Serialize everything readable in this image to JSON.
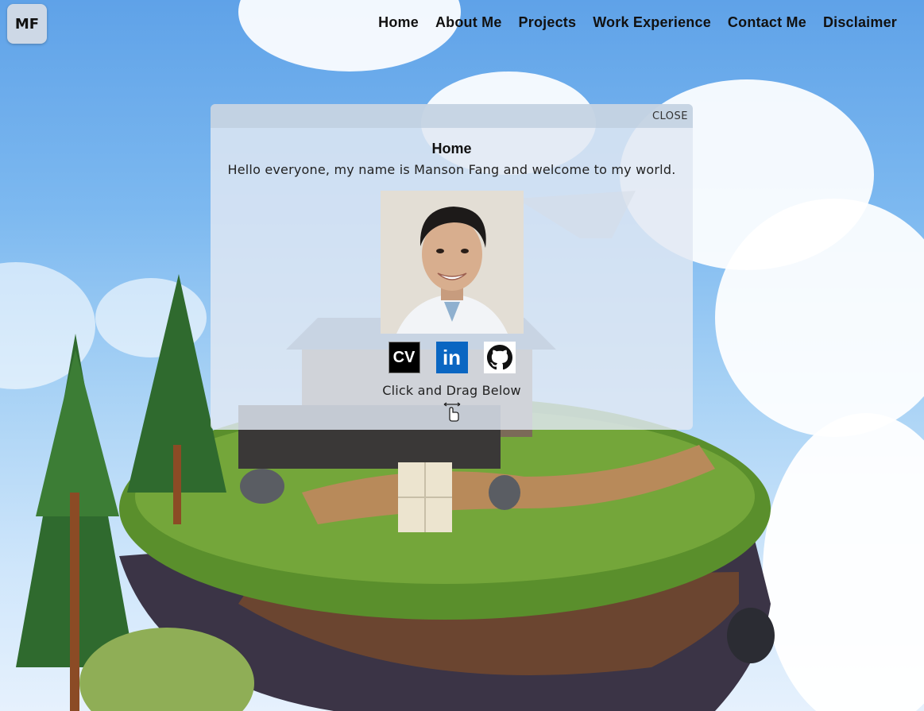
{
  "logo": {
    "label": "MF"
  },
  "nav": {
    "items": [
      "Home",
      "About Me",
      "Projects",
      "Work Experience",
      "Contact Me",
      "Disclaimer"
    ]
  },
  "panel": {
    "close_label": "CLOSE",
    "title": "Home",
    "text": "Hello everyone, my name is Manson Fang and welcome to my world.",
    "social": {
      "cv_label": "CV",
      "linkedin_label": "in"
    },
    "drag_label": "Click and Drag Below",
    "icons": [
      "cv-icon",
      "linkedin-icon",
      "github-icon",
      "drag-hand-icon"
    ]
  },
  "colors": {
    "sky": "#6aaceb",
    "panel": "#e1e8f3",
    "linkedin": "#0a66c2"
  }
}
